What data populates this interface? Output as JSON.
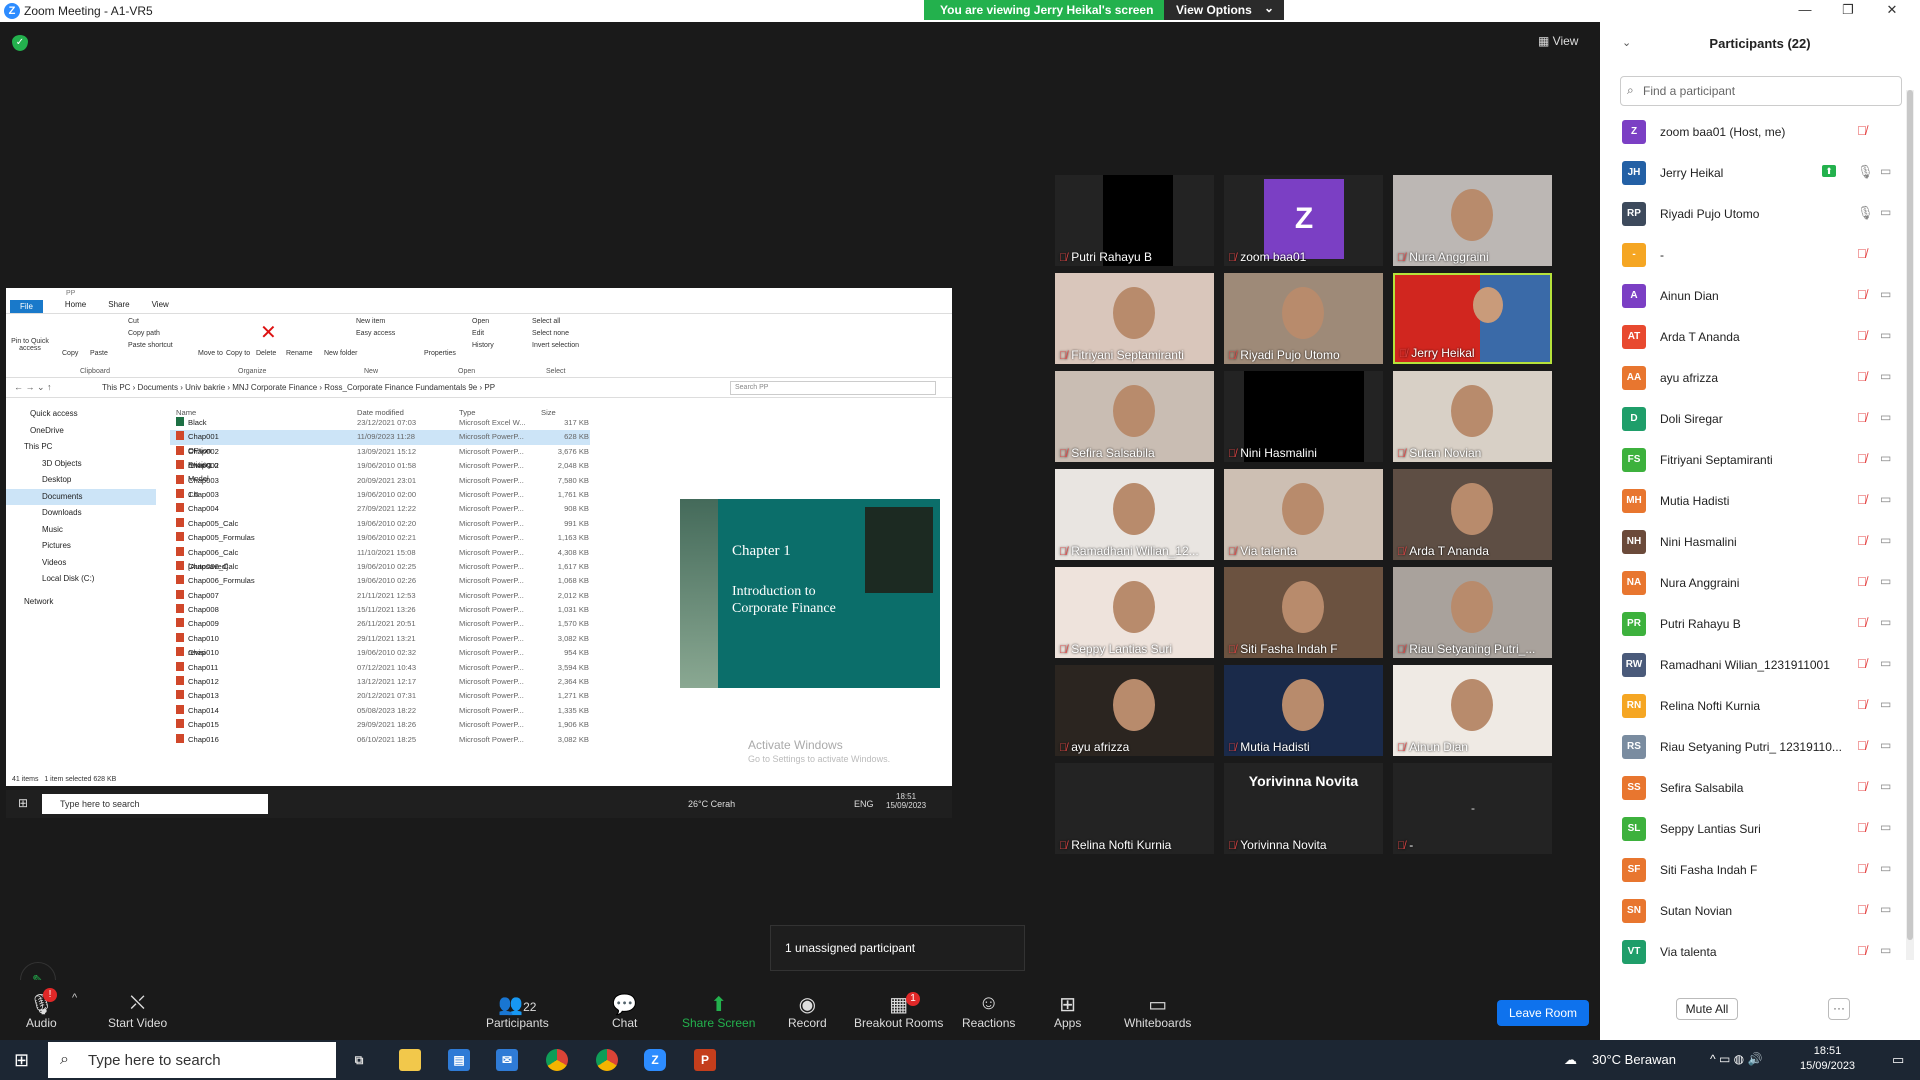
{
  "window": {
    "title": "Zoom Meeting - A1-VR5",
    "minimize": "—",
    "maximize": "❐",
    "close": "✕"
  },
  "banner": {
    "viewing": "You are viewing Jerry Heikal's screen",
    "view_options": "View Options",
    "view_options_chevron": "⌄"
  },
  "view_button": "View",
  "shared_screen": {
    "window_title": "PP",
    "ribbon_tabs": [
      "File",
      "Home",
      "Share",
      "View"
    ],
    "ribbon_buttons": [
      "Pin to Quick access",
      "Copy",
      "Paste",
      "Cut",
      "Copy path",
      "Paste shortcut",
      "Move to",
      "Copy to",
      "Delete",
      "Rename",
      "New folder",
      "New item",
      "Easy access",
      "Properties",
      "Open",
      "Edit",
      "History",
      "Select all",
      "Select none",
      "Invert selection"
    ],
    "ribbon_groups": [
      "Clipboard",
      "Organize",
      "New",
      "Open",
      "Select"
    ],
    "path": "This PC  ›  Documents  ›  Univ bakrie  ›  MNJ Corporate Finance  ›  Ross_Corporate Finance Fundamentals 9e  ›  PP",
    "search_placeholder": "Search PP",
    "nav": [
      "Quick access",
      "OneDrive",
      "This PC",
      "3D Objects",
      "Desktop",
      "Documents",
      "Downloads",
      "Music",
      "Pictures",
      "Videos",
      "Local Disk (C:)",
      "Network"
    ],
    "columns": [
      "Name",
      "Date modified",
      "Type",
      "Size"
    ],
    "files": [
      {
        "name": "Black Scholes OPtion Pricing Model",
        "date": "23/12/2021 07:03",
        "type": "Microsoft Excel W...",
        "size": "317 KB"
      },
      {
        "name": "Chap001",
        "date": "11/09/2023 11:28",
        "type": "Microsoft PowerP...",
        "size": "628 KB"
      },
      {
        "name": "Chap002 revisi 1.0",
        "date": "13/09/2021 15:12",
        "type": "Microsoft PowerP...",
        "size": "3,676 KB"
      },
      {
        "name": "Chap002",
        "date": "19/06/2010 01:58",
        "type": "Microsoft PowerP...",
        "size": "2,048 KB"
      },
      {
        "name": "Chap003 1.0",
        "date": "20/09/2021 23:01",
        "type": "Microsoft PowerP...",
        "size": "7,580 KB"
      },
      {
        "name": "Chap003",
        "date": "19/06/2010 02:00",
        "type": "Microsoft PowerP...",
        "size": "1,761 KB"
      },
      {
        "name": "Chap004",
        "date": "27/09/2021 12:22",
        "type": "Microsoft PowerP...",
        "size": "908 KB"
      },
      {
        "name": "Chap005_Calc",
        "date": "19/06/2010 02:20",
        "type": "Microsoft PowerP...",
        "size": "991 KB"
      },
      {
        "name": "Chap005_Formulas",
        "date": "19/06/2010 02:21",
        "type": "Microsoft PowerP...",
        "size": "1,163 KB"
      },
      {
        "name": "Chap006_Calc [Autosaved]",
        "date": "11/10/2021 15:08",
        "type": "Microsoft PowerP...",
        "size": "4,308 KB"
      },
      {
        "name": "Chap006_Calc",
        "date": "19/06/2010 02:25",
        "type": "Microsoft PowerP...",
        "size": "1,617 KB"
      },
      {
        "name": "Chap006_Formulas",
        "date": "19/06/2010 02:26",
        "type": "Microsoft PowerP...",
        "size": "1,068 KB"
      },
      {
        "name": "Chap007",
        "date": "21/11/2021 12:53",
        "type": "Microsoft PowerP...",
        "size": "2,012 KB"
      },
      {
        "name": "Chap008",
        "date": "15/11/2021 13:26",
        "type": "Microsoft PowerP...",
        "size": "1,031 KB"
      },
      {
        "name": "Chap009",
        "date": "26/11/2021 20:51",
        "type": "Microsoft PowerP...",
        "size": "1,570 KB"
      },
      {
        "name": "Chap010 revisi",
        "date": "29/11/2021 13:21",
        "type": "Microsoft PowerP...",
        "size": "3,082 KB"
      },
      {
        "name": "Chap010",
        "date": "19/06/2010 02:32",
        "type": "Microsoft PowerP...",
        "size": "954 KB"
      },
      {
        "name": "Chap011",
        "date": "07/12/2021 10:43",
        "type": "Microsoft PowerP...",
        "size": "3,594 KB"
      },
      {
        "name": "Chap012",
        "date": "13/12/2021 12:17",
        "type": "Microsoft PowerP...",
        "size": "2,364 KB"
      },
      {
        "name": "Chap013",
        "date": "20/12/2021 07:31",
        "type": "Microsoft PowerP...",
        "size": "1,271 KB"
      },
      {
        "name": "Chap014",
        "date": "05/08/2023 18:22",
        "type": "Microsoft PowerP...",
        "size": "1,335 KB"
      },
      {
        "name": "Chap015",
        "date": "29/09/2021 18:26",
        "type": "Microsoft PowerP...",
        "size": "1,906 KB"
      },
      {
        "name": "Chap016",
        "date": "06/10/2021 18:25",
        "type": "Microsoft PowerP...",
        "size": "3,082 KB"
      }
    ],
    "preview": {
      "chapter": "Chapter 1",
      "title_line1": "Introduction to",
      "title_line2": "Corporate Finance"
    },
    "activate_title": "Activate Windows",
    "activate_sub": "Go to Settings to activate Windows.",
    "status_items": "41 items",
    "status_selected": "1 item selected  628 KB",
    "inner_taskbar": {
      "search": "Type here to search",
      "weather": "26°C  Cerah",
      "lang": "ENG",
      "time": "18:51",
      "date": "15/09/2023"
    }
  },
  "tiles": [
    {
      "name": "Putri Rahayu B"
    },
    {
      "name": "zoom baa01",
      "initial": "Z"
    },
    {
      "name": "Nura Anggraini"
    },
    {
      "name": "Fitriyani Septamiranti"
    },
    {
      "name": "Riyadi Pujo Utomo"
    },
    {
      "name": "Jerry Heikal"
    },
    {
      "name": "Sefira Salsabila"
    },
    {
      "name": "Nini Hasmalini"
    },
    {
      "name": "Sutan Novian"
    },
    {
      "name": "Ramadhani Wilian_12..."
    },
    {
      "name": "Via talenta"
    },
    {
      "name": "Arda T Ananda"
    },
    {
      "name": "Seppy Lantias Suri"
    },
    {
      "name": "Siti Fasha Indah F"
    },
    {
      "name": "Riau Setyaning Putri_..."
    },
    {
      "name": "ayu afrizza"
    },
    {
      "name": "Mutia Hadisti"
    },
    {
      "name": "Ainun Dian"
    },
    {
      "name": "Relina Nofti Kurnia"
    },
    {
      "name": "Doli Siregar"
    },
    {
      "name": "-"
    },
    {
      "name": "Yorivinna Novita",
      "display": "Yorivinna Novita"
    }
  ],
  "unassigned": "1 unassigned participant",
  "toolbar": {
    "audio": "Audio",
    "start_video": "Start Video",
    "participants": "Participants",
    "participants_count": "22",
    "chat": "Chat",
    "share_screen": "Share Screen",
    "record": "Record",
    "breakout_rooms": "Breakout Rooms",
    "breakout_badge": "1",
    "reactions": "Reactions",
    "apps": "Apps",
    "whiteboards": "Whiteboards",
    "leave_room": "Leave Room",
    "audio_badge": "!"
  },
  "panel": {
    "title": "Participants (22)",
    "search_placeholder": "Find a participant",
    "participants": [
      {
        "name": "zoom baa01 (Host, me)",
        "initials": "Z",
        "color": "#7b3fc4",
        "cam": false
      },
      {
        "name": "Jerry Heikal",
        "initials": "JH",
        "color": "#2360a5",
        "cam": true,
        "sharing": true,
        "mic_on": true
      },
      {
        "name": "Riyadi Pujo Utomo",
        "initials": "RP",
        "color": "#3d4a5c",
        "cam": true,
        "mic_on": true
      },
      {
        "name": "-",
        "initials": "-",
        "color": "#f5a623",
        "cam": false
      },
      {
        "name": "Ainun Dian",
        "initials": "A",
        "color": "#7b3fc4",
        "cam": true
      },
      {
        "name": "Arda T Ananda",
        "initials": "AT",
        "color": "#e8492f",
        "cam": true
      },
      {
        "name": "ayu afrizza",
        "initials": "AA",
        "color": "#e8762f",
        "cam": true
      },
      {
        "name": "Doli Siregar",
        "initials": "D",
        "color": "#1f9e6a",
        "cam": true
      },
      {
        "name": "Fitriyani Septamiranti",
        "initials": "FS",
        "color": "#3db13d",
        "cam": true
      },
      {
        "name": "Mutia Hadisti",
        "initials": "MH",
        "color": "#e8762f",
        "cam": true
      },
      {
        "name": "Nini Hasmalini",
        "initials": "NH",
        "color": "#6b4a3a",
        "cam": true
      },
      {
        "name": "Nura Anggraini",
        "initials": "NA",
        "color": "#e8762f",
        "cam": true
      },
      {
        "name": "Putri Rahayu B",
        "initials": "PR",
        "color": "#3db13d",
        "cam": true
      },
      {
        "name": "Ramadhani Wilian_1231911001",
        "initials": "RW",
        "color": "#4a5a7a",
        "cam": true
      },
      {
        "name": "Relina Nofti Kurnia",
        "initials": "RN",
        "color": "#f5a623",
        "cam": true
      },
      {
        "name": "Riau Setyaning Putri_ 12319110...",
        "initials": "RS",
        "color": "#7a8ca0",
        "cam": true
      },
      {
        "name": "Sefira Salsabila",
        "initials": "SS",
        "color": "#e8762f",
        "cam": true
      },
      {
        "name": "Seppy Lantias Suri",
        "initials": "SL",
        "color": "#3db13d",
        "cam": true
      },
      {
        "name": "Siti Fasha Indah F",
        "initials": "SF",
        "color": "#e8762f",
        "cam": true
      },
      {
        "name": "Sutan Novian",
        "initials": "SN",
        "color": "#e8762f",
        "cam": true
      },
      {
        "name": "Via talenta",
        "initials": "VT",
        "color": "#1f9e6a",
        "cam": true
      }
    ],
    "mute_all": "Mute All",
    "more": "···"
  },
  "taskbar": {
    "search": "Type here to search",
    "weather": "30°C  Berawan",
    "time": "18:51",
    "date": "15/09/2023"
  }
}
